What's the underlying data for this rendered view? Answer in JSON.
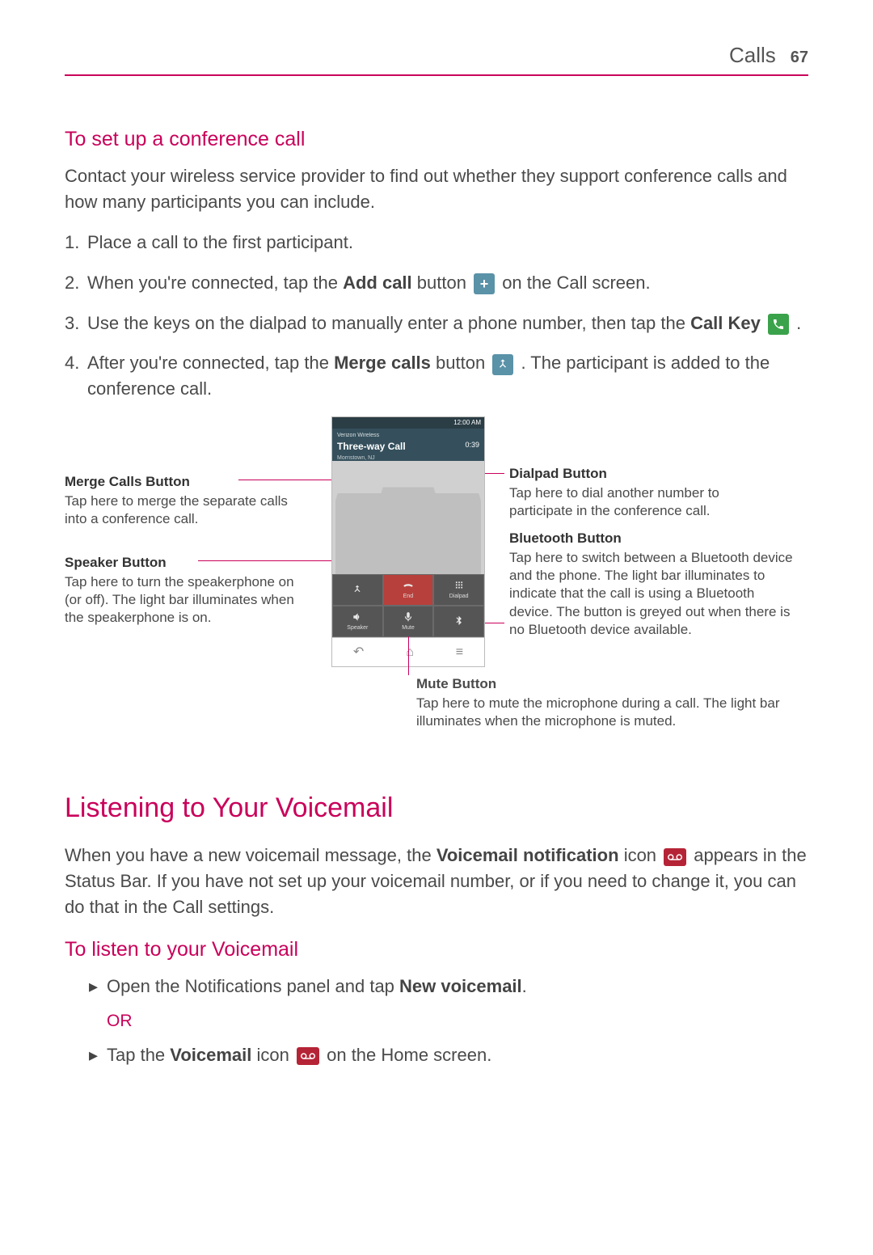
{
  "header": {
    "section": "Calls",
    "page": "67"
  },
  "conf": {
    "heading": "To set up a conference call",
    "intro": "Contact your wireless service provider to find out whether they support conference calls and how many participants you can include.",
    "steps": {
      "s1": {
        "n": "1.",
        "text": "Place a call to the first participant."
      },
      "s2": {
        "n": "2.",
        "pre": "When you're connected, tap the ",
        "bold": "Add call",
        "mid": " button ",
        "post": " on the Call screen."
      },
      "s3": {
        "n": "3.",
        "pre": "Use the keys on the dialpad to manually enter a phone number, then tap the ",
        "bold": "Call Key",
        "post": " ."
      },
      "s4": {
        "n": "4.",
        "pre": "After you're connected, tap the ",
        "bold": "Merge calls",
        "mid": " button ",
        "post": ". The participant is added to the conference call."
      }
    }
  },
  "phone": {
    "status_time": "12:00 AM",
    "carrier": "Verizon Wireless",
    "call_name": "Three-way Call",
    "location": "Morristown, NJ",
    "timer": "0:39",
    "buttons": {
      "merge": "",
      "end": "End",
      "dialpad": "Dialpad",
      "speaker": "Speaker",
      "mute": "Mute",
      "bt": ""
    }
  },
  "callouts": {
    "merge": {
      "title": "Merge Calls Button",
      "desc": "Tap here to merge the separate calls into a conference call."
    },
    "speaker": {
      "title": "Speaker Button",
      "desc": "Tap here to turn the speakerphone on (or off). The light bar illuminates when the speakerphone is on."
    },
    "dialpad": {
      "title": "Dialpad Button",
      "desc": "Tap here to dial another number to participate in the conference call."
    },
    "bt": {
      "title": "Bluetooth Button",
      "desc": "Tap here to switch between a Bluetooth device and the phone. The light bar illuminates to indicate that the call is using a Bluetooth device. The button is greyed out when there is no Bluetooth device available."
    },
    "mute": {
      "title": "Mute Button",
      "desc": "Tap here to mute the microphone during a call. The light bar illuminates when the microphone is muted."
    }
  },
  "vm": {
    "heading": "Listening to Your Voicemail",
    "intro_pre": "When you have a new voicemail message, the ",
    "intro_bold": "Voicemail notification",
    "intro_mid": " icon ",
    "intro_post": " appears in the Status Bar. If you have not set up your voicemail number, or if you need to change it, you can do that in the Call settings.",
    "sub": "To listen to your Voicemail",
    "b1_pre": "Open the Notifications panel and tap ",
    "b1_bold": "New voicemail",
    "b1_post": ".",
    "or": "OR",
    "b2_pre": "Tap the ",
    "b2_bold": "Voicemail",
    "b2_mid": " icon ",
    "b2_post": " on the Home screen."
  }
}
